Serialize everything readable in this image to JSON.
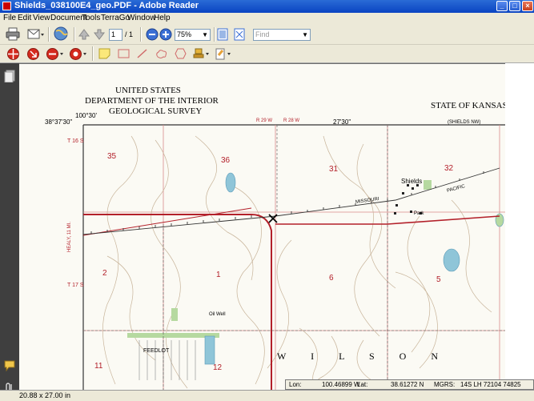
{
  "window": {
    "title": "Shields_038100E4_geo.PDF - Adobe Reader",
    "min": "_",
    "max": "□",
    "close": "×"
  },
  "menu": [
    "File",
    "Edit",
    "View",
    "Document",
    "Tools",
    "TerraGo",
    "Window",
    "Help"
  ],
  "toolbar": {
    "page_current": "1",
    "page_total": "/ 1",
    "zoom": "75%",
    "find_placeholder": "Find"
  },
  "map": {
    "agency_line1": "UNITED STATES",
    "agency_line2": "DEPARTMENT OF THE INTERIOR",
    "agency_line3": "GEOLOGICAL SURVEY",
    "state": "STATE OF KANSAS",
    "corner_lon": "100°30'",
    "corner_lat": "38°37'30\"",
    "lon_mid": "27'30\"",
    "range_labels": [
      "R 29 W",
      "R 28 W"
    ],
    "township_top": "T 16 S",
    "township_bottom": "T 17 S",
    "sections": [
      "35",
      "36",
      "31",
      "32",
      "2",
      "1",
      "6",
      "5",
      "11",
      "12"
    ],
    "town": "Shields",
    "railroad": "MISSOURI",
    "railroad2": "PACIFIC",
    "park": "Park",
    "feedlot": "FEEDLOT",
    "county": "W I L S O N",
    "oil_well": "Oil Well",
    "adjoin_ne": "(SHIELDS NW)",
    "highway_note": "HEALY, 11 MI."
  },
  "coords": {
    "lon_label": "Lon:",
    "lon": "100.46899 W",
    "lat_label": "Lat:",
    "lat": "38.61272 N",
    "mgrs_label": "MGRS:",
    "mgrs": "14S LH 72104 74825"
  },
  "status": {
    "page_size": "20.88 x 27.00 in"
  },
  "colors": {
    "road": "#b3202a",
    "contour": "#c8b49a",
    "grid": "#d98a8a",
    "water": "#8fc5d8",
    "vegetation": "#b6d9a0"
  }
}
